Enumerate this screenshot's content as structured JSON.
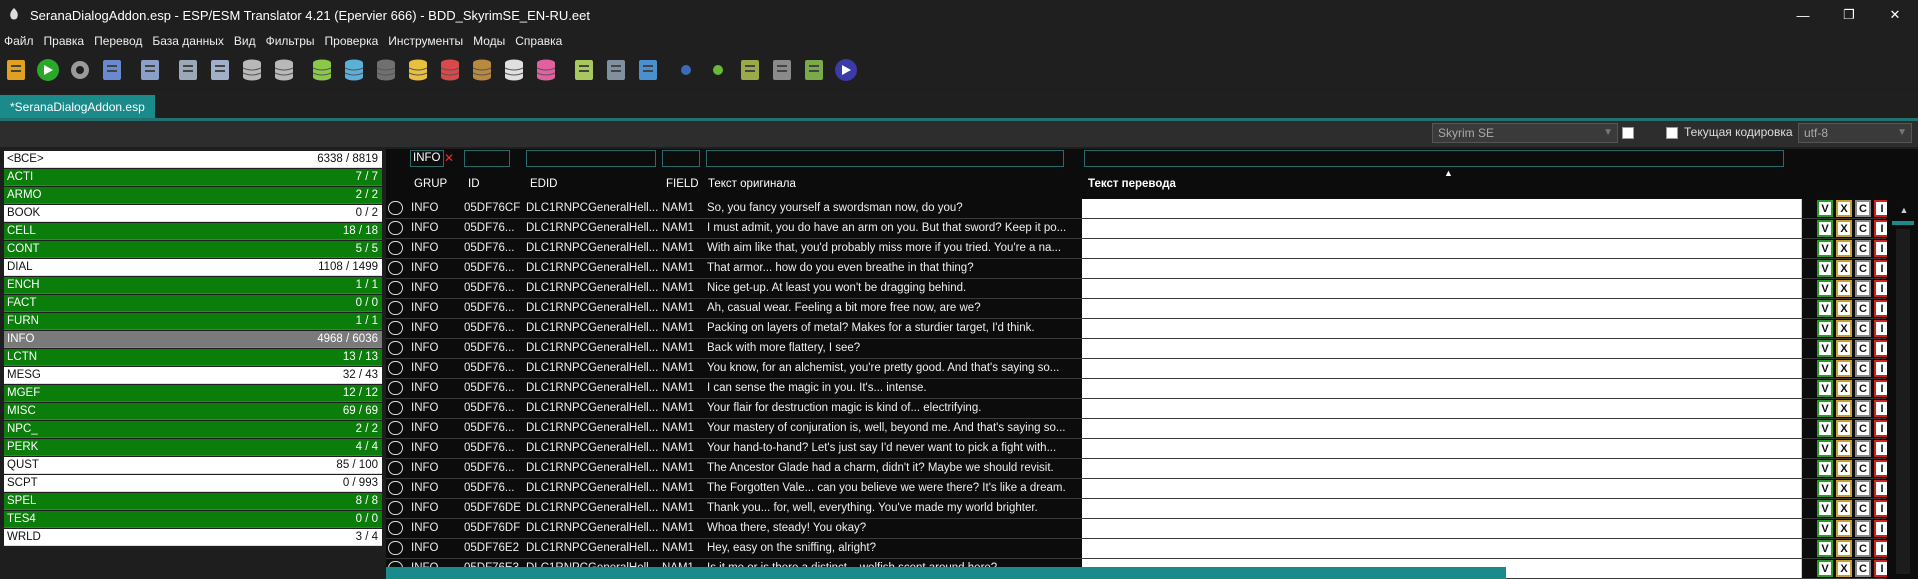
{
  "window": {
    "title": "SeranaDialogAddon.esp - ESP/ESM Translator 4.21 (Epervier 666) - BDD_SkyrimSE_EN-RU.eet",
    "controls": [
      "—",
      "❐",
      "✕"
    ]
  },
  "menu": [
    "Файл",
    "Правка",
    "Перевод",
    "База данных",
    "Вид",
    "Фильтры",
    "Проверка",
    "Инструменты",
    "Моды",
    "Справка"
  ],
  "toolbar_icons": [
    {
      "name": "open-folder-icon",
      "color": "#e0a020"
    },
    {
      "name": "go-arrow-icon",
      "color": "#2aa82a"
    },
    {
      "name": "gear-icon",
      "color": "#9a9a9a"
    },
    {
      "name": "chart-icon",
      "color": "#6a8ad0"
    },
    {
      "name": "edit-doc-icon",
      "color": "#8aa0c8"
    },
    {
      "name": "save-doc-icon",
      "color": "#9aa8b8"
    },
    {
      "name": "copy-doc-icon",
      "color": "#a0b0c8"
    },
    {
      "name": "database-icon",
      "color": "#b8b8b8"
    },
    {
      "name": "database-export-icon",
      "color": "#b8b8b8"
    },
    {
      "name": "database-green-icon",
      "color": "#8ac84a"
    },
    {
      "name": "database-blue-icon",
      "color": "#5ab0d8"
    },
    {
      "name": "database-gray-icon",
      "color": "#707070"
    },
    {
      "name": "database-yellow-icon",
      "color": "#e8c040"
    },
    {
      "name": "database-red-icon",
      "color": "#d84a4a"
    },
    {
      "name": "database-brown-icon",
      "color": "#b88a40"
    },
    {
      "name": "database-white-icon",
      "color": "#e0e0e0"
    },
    {
      "name": "database-pink-icon",
      "color": "#e060a0"
    },
    {
      "name": "script-icon",
      "color": "#a8c860"
    },
    {
      "name": "tree-icon",
      "color": "#8090a0"
    },
    {
      "name": "spellcheck-icon",
      "color": "#4a90d0"
    },
    {
      "name": "blue-dot-icon",
      "color": "#3a6ab8"
    },
    {
      "name": "green-dot-icon",
      "color": "#6ab83a"
    },
    {
      "name": "package-icon",
      "color": "#9aaa4a"
    },
    {
      "name": "book-icon",
      "color": "#8a8a8a"
    },
    {
      "name": "box-icon",
      "color": "#7aaa4a"
    },
    {
      "name": "play-icon",
      "color": "#3a3aa8"
    }
  ],
  "tabs": [
    {
      "label": "*SeranaDialogAddon.esp"
    }
  ],
  "options": {
    "game_select": "Skyrim SE",
    "current_encoding_label": "Текущая кодировка",
    "encoding_select": "utf-8"
  },
  "records": [
    {
      "code": "<ВСЕ>",
      "count": "6338 / 8819",
      "style": "white"
    },
    {
      "code": "ACTI",
      "count": "7 / 7",
      "style": "green"
    },
    {
      "code": "ARMO",
      "count": "2 / 2",
      "style": "green"
    },
    {
      "code": "BOOK",
      "count": "0 / 2",
      "style": "white"
    },
    {
      "code": "CELL",
      "count": "18 / 18",
      "style": "green"
    },
    {
      "code": "CONT",
      "count": "5 / 5",
      "style": "green"
    },
    {
      "code": "DIAL",
      "count": "1108 / 1499",
      "style": "white"
    },
    {
      "code": "ENCH",
      "count": "1 / 1",
      "style": "green"
    },
    {
      "code": "FACT",
      "count": "0 / 0",
      "style": "green"
    },
    {
      "code": "FURN",
      "count": "1 / 1",
      "style": "green"
    },
    {
      "code": "INFO",
      "count": "4968 / 6036",
      "style": "gray"
    },
    {
      "code": "LCTN",
      "count": "13 / 13",
      "style": "green"
    },
    {
      "code": "MESG",
      "count": "32 / 43",
      "style": "white"
    },
    {
      "code": "MGEF",
      "count": "12 / 12",
      "style": "green"
    },
    {
      "code": "MISC",
      "count": "69 / 69",
      "style": "green"
    },
    {
      "code": "NPC_",
      "count": "2 / 2",
      "style": "green"
    },
    {
      "code": "PERK",
      "count": "4 / 4",
      "style": "green"
    },
    {
      "code": "QUST",
      "count": "85 / 100",
      "style": "white"
    },
    {
      "code": "SCPT",
      "count": "0 / 993",
      "style": "white"
    },
    {
      "code": "SPEL",
      "count": "8 / 8",
      "style": "green"
    },
    {
      "code": "TES4",
      "count": "0 / 0",
      "style": "green"
    },
    {
      "code": "WRLD",
      "count": "3 / 4",
      "style": "white"
    }
  ],
  "filters": {
    "grup": "INFO",
    "clear_icon": "✕"
  },
  "columns": {
    "grup": "GRUP",
    "id": "ID",
    "edid": "EDID",
    "field": "FIELD",
    "original": "Текст оригинала",
    "translation": "Текст перевода",
    "sort_indicator": "▲"
  },
  "rows": [
    {
      "grup": "INFO",
      "id": "05DF76CF",
      "edid": "DLC1RNPCGeneralHell...",
      "field": "NAM1",
      "text": "So, you fancy yourself a swordsman now, do you?"
    },
    {
      "grup": "INFO",
      "id": "05DF76...",
      "edid": "DLC1RNPCGeneralHell...",
      "field": "NAM1",
      "text": "I must admit, you do have an arm on you. But that sword? Keep it po..."
    },
    {
      "grup": "INFO",
      "id": "05DF76...",
      "edid": "DLC1RNPCGeneralHell...",
      "field": "NAM1",
      "text": "With aim like that, you'd probably miss more if you tried. You're a na..."
    },
    {
      "grup": "INFO",
      "id": "05DF76...",
      "edid": "DLC1RNPCGeneralHell...",
      "field": "NAM1",
      "text": "That armor... how do you even breathe in that thing?"
    },
    {
      "grup": "INFO",
      "id": "05DF76...",
      "edid": "DLC1RNPCGeneralHell...",
      "field": "NAM1",
      "text": "Nice get-up. At least you won't be dragging behind."
    },
    {
      "grup": "INFO",
      "id": "05DF76...",
      "edid": "DLC1RNPCGeneralHell...",
      "field": "NAM1",
      "text": "Ah, casual wear. Feeling a bit more free now, are we?"
    },
    {
      "grup": "INFO",
      "id": "05DF76...",
      "edid": "DLC1RNPCGeneralHell...",
      "field": "NAM1",
      "text": "Packing on layers of metal? Makes for a sturdier target, I'd think."
    },
    {
      "grup": "INFO",
      "id": "05DF76...",
      "edid": "DLC1RNPCGeneralHell...",
      "field": "NAM1",
      "text": "Back with more flattery, I see?"
    },
    {
      "grup": "INFO",
      "id": "05DF76...",
      "edid": "DLC1RNPCGeneralHell...",
      "field": "NAM1",
      "text": "You know, for an alchemist, you're pretty good. And that's saying so..."
    },
    {
      "grup": "INFO",
      "id": "05DF76...",
      "edid": "DLC1RNPCGeneralHell...",
      "field": "NAM1",
      "text": "I can sense the magic in you. It's... intense."
    },
    {
      "grup": "INFO",
      "id": "05DF76...",
      "edid": "DLC1RNPCGeneralHell...",
      "field": "NAM1",
      "text": "Your flair for destruction magic is kind of... electrifying."
    },
    {
      "grup": "INFO",
      "id": "05DF76...",
      "edid": "DLC1RNPCGeneralHell...",
      "field": "NAM1",
      "text": "Your mastery of conjuration is, well, beyond me. And that's saying so..."
    },
    {
      "grup": "INFO",
      "id": "05DF76...",
      "edid": "DLC1RNPCGeneralHell...",
      "field": "NAM1",
      "text": "Your hand-to-hand? Let's just say I'd never want to pick a fight with..."
    },
    {
      "grup": "INFO",
      "id": "05DF76...",
      "edid": "DLC1RNPCGeneralHell...",
      "field": "NAM1",
      "text": "The Ancestor Glade had a charm, didn't it? Maybe we should revisit."
    },
    {
      "grup": "INFO",
      "id": "05DF76...",
      "edid": "DLC1RNPCGeneralHell...",
      "field": "NAM1",
      "text": "The Forgotten Vale... can you believe we were there? It's like a dream."
    },
    {
      "grup": "INFO",
      "id": "05DF76DE",
      "edid": "DLC1RNPCGeneralHell...",
      "field": "NAM1",
      "text": "Thank you... for, well, everything. You've made my world brighter."
    },
    {
      "grup": "INFO",
      "id": "05DF76DF",
      "edid": "DLC1RNPCGeneralHell...",
      "field": "NAM1",
      "text": "Whoa there, steady! You okay?"
    },
    {
      "grup": "INFO",
      "id": "05DF76E2",
      "edid": "DLC1RNPCGeneralHell...",
      "field": "NAM1",
      "text": "Hey, easy on the sniffing, alright?"
    },
    {
      "grup": "INFO",
      "id": "05DF76E3",
      "edid": "DLC1RNPCGeneralHell...",
      "field": "NAM1",
      "text": "Is it me or is there a distinct... wolfish scent around here?"
    }
  ],
  "row_buttons": [
    "V",
    "X",
    "C",
    "I"
  ],
  "colors": {
    "accent": "#1a8a8a",
    "green_row": "#0a7d0a",
    "selected_row": "#7a7a7a"
  }
}
